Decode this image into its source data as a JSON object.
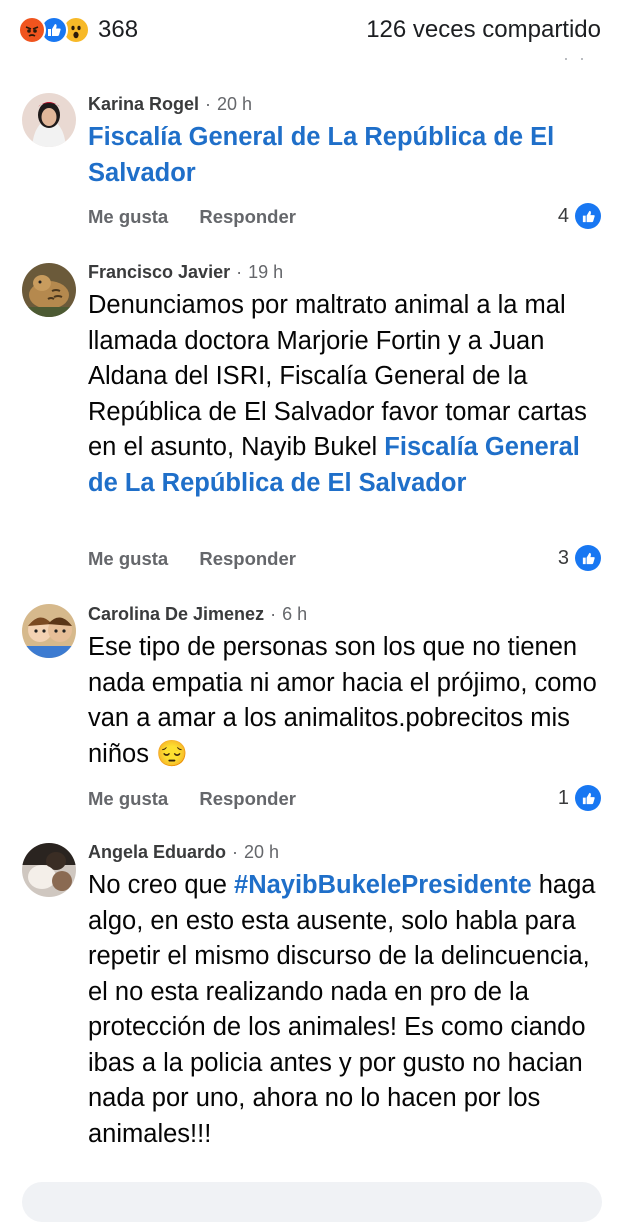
{
  "header": {
    "reaction_icons": [
      "angry-icon",
      "like-icon",
      "wow-icon"
    ],
    "reaction_count": "368",
    "shares": "126 veces compartido"
  },
  "comments": [
    {
      "author": "Karina Rogel",
      "time": "20 h",
      "text": "",
      "mention": "Fiscalía General de La República de El Salvador",
      "like_label": "Me gusta",
      "reply_label": "Responder",
      "likes": "4"
    },
    {
      "author": "Francisco Javier",
      "time": "19 h",
      "text": "Denunciamos por maltrato animal a la mal llamada doctora Marjorie Fortin y a Juan Aldana del ISRI, Fiscalía General de la República de El Salvador favor tomar cartas en el asunto, Nayib Bukel",
      "mention": "Fiscalía General de La República de El Salvador",
      "like_label": "Me gusta",
      "reply_label": "Responder",
      "likes": "3"
    },
    {
      "author": "Carolina De Jimenez",
      "time": "6 h",
      "text": "Ese tipo de personas son los que no tienen nada empatia ni amor hacia el prójimo, como van a amar a los animalitos.pobrecitos mis niños",
      "emoji": "😔",
      "like_label": "Me gusta",
      "reply_label": "Responder",
      "likes": "1"
    },
    {
      "author": "Angela Eduardo",
      "time": "20 h",
      "text_before": "No creo que",
      "hashtag": "#NayibBukelePresidente",
      "text_after": "haga algo, en esto esta ausente, solo habla para repetir el mismo discurso de la delincuencia, el no esta realizando nada en pro de la protección de los animales! Es como ciando ibas a la policia antes y por gusto no hacian nada por uno, ahora no lo hacen por los animales!!!"
    }
  ]
}
